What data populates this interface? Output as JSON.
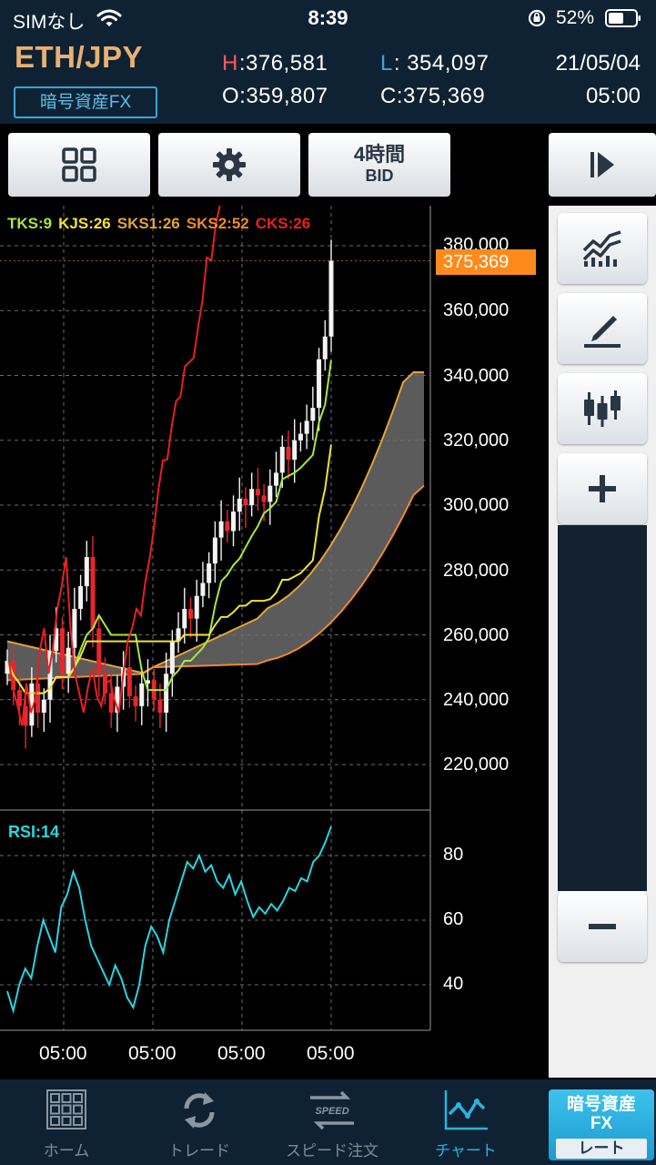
{
  "status_bar": {
    "carrier": "SIMなし",
    "time": "8:39",
    "battery": "52%"
  },
  "header": {
    "pair": "ETH/JPY",
    "badge": "暗号資産FX",
    "high_key": "H",
    "high": ":376,581",
    "low_key": "L",
    "low": ": 354,097",
    "open": "O:359,807",
    "close": "C:375,369",
    "date": "21/05/04",
    "time": "05:00"
  },
  "toolbar": {
    "timeframe_top": "4時間",
    "timeframe_bottom": "BID"
  },
  "legend": {
    "tks": "TKS:9",
    "kjs": "KJS:26",
    "sks1": "SKS1:26",
    "sks2": "SKS2:52",
    "cks": "CKS:26"
  },
  "price_tag": "375,369",
  "y_axis": [
    "380,000",
    "360,000",
    "340,000",
    "320,000",
    "300,000",
    "280,000",
    "260,000",
    "240,000",
    "220,000"
  ],
  "rsi": {
    "label": "RSI:14",
    "y_axis": [
      "80",
      "60",
      "40"
    ]
  },
  "x_axis": [
    "05:00",
    "05:00",
    "05:00",
    "05:00"
  ],
  "tabs": {
    "home": "ホーム",
    "trade": "トレード",
    "speed": "スピード注文",
    "speed_icon_text": "SPEED",
    "chart": "チャート",
    "fx_line1": "暗号資産",
    "fx_line2": "FX",
    "fx_line3": "レート"
  },
  "colors": {
    "tks": "#a8e83c",
    "kjs": "#f2e23a",
    "sks1": "#e3a43a",
    "sks2": "#f08a2a",
    "cks": "#e82020",
    "rsi": "#27d6e0",
    "accent": "#2ab3e0",
    "price_tag": "#ff8a1c"
  },
  "chart_data": {
    "type": "candlestick",
    "symbol": "ETH/JPY",
    "timeframe": "4時間",
    "price_type": "BID",
    "price_ylim": [
      215000,
      385000
    ],
    "last_price": 375369,
    "ohlc_latest": {
      "open": 359807,
      "high": 376581,
      "low": 354097,
      "close": 375369
    },
    "candles_close_approx": [
      252000,
      243000,
      238000,
      232000,
      245000,
      236000,
      240000,
      255000,
      262000,
      248000,
      256000,
      268000,
      275000,
      284000,
      262000,
      248000,
      242000,
      236000,
      244000,
      250000,
      241000,
      238000,
      245000,
      246000,
      240000,
      236000,
      248000,
      258000,
      262000,
      268000,
      265000,
      272000,
      276000,
      282000,
      290000,
      295000,
      292000,
      298000,
      302000,
      300000,
      305000,
      303000,
      301000,
      306000,
      310000,
      318000,
      314000,
      320000,
      322000,
      326000,
      330000,
      345000,
      352000,
      375369
    ],
    "rsi_period": 14,
    "rsi_ylim": [
      30,
      95
    ],
    "rsi_values_approx": [
      38,
      32,
      40,
      45,
      42,
      52,
      60,
      55,
      50,
      64,
      68,
      75,
      70,
      60,
      52,
      48,
      44,
      40,
      46,
      42,
      36,
      33,
      40,
      52,
      58,
      55,
      50,
      60,
      66,
      72,
      78,
      76,
      80,
      75,
      77,
      72,
      70,
      74,
      68,
      72,
      66,
      61,
      64,
      62,
      65,
      63,
      66,
      70,
      69,
      73,
      72,
      78,
      80,
      84,
      89
    ]
  }
}
